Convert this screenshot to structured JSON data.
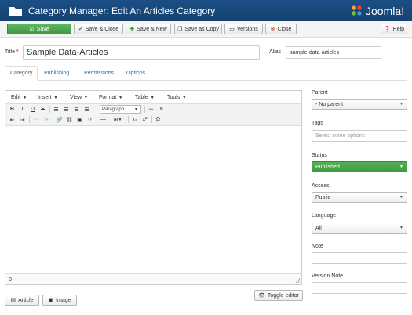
{
  "header": {
    "title": "Category Manager: Edit An Articles Category",
    "logo_text": "Joomla!"
  },
  "toolbar": {
    "save": "Save",
    "save_close": "Save & Close",
    "save_new": "Save & New",
    "save_copy": "Save as Copy",
    "versions": "Versions",
    "close": "Close",
    "help": "Help"
  },
  "form": {
    "title_label": "Title",
    "title_required_mark": "*",
    "title_value": "Sample Data-Articles",
    "alias_label": "Alias",
    "alias_value": "sample-data-articles"
  },
  "tabs": [
    "Category",
    "Publishing",
    "Permissions",
    "Options"
  ],
  "editor": {
    "menus": [
      "Edit",
      "Insert",
      "View",
      "Format",
      "Table",
      "Tools"
    ],
    "paragraph_format": "Paragraph",
    "status_path": "p"
  },
  "buttons": {
    "article": "Article",
    "image": "Image",
    "toggle_editor": "Toggle editor"
  },
  "sidebar": {
    "parent_label": "Parent",
    "parent_value": "- No parent",
    "tags_label": "Tags",
    "tags_placeholder": "Select some options",
    "status_label": "Status",
    "status_value": "Published",
    "access_label": "Access",
    "access_value": "Public",
    "language_label": "Language",
    "language_value": "All",
    "note_label": "Note",
    "note_value": "",
    "version_note_label": "Version Note",
    "version_note_value": ""
  },
  "colors": {
    "header_bg": "#1b4f86",
    "save_green": "#47a447",
    "link_blue": "#1a6fb5",
    "close_red": "#c9302c"
  }
}
